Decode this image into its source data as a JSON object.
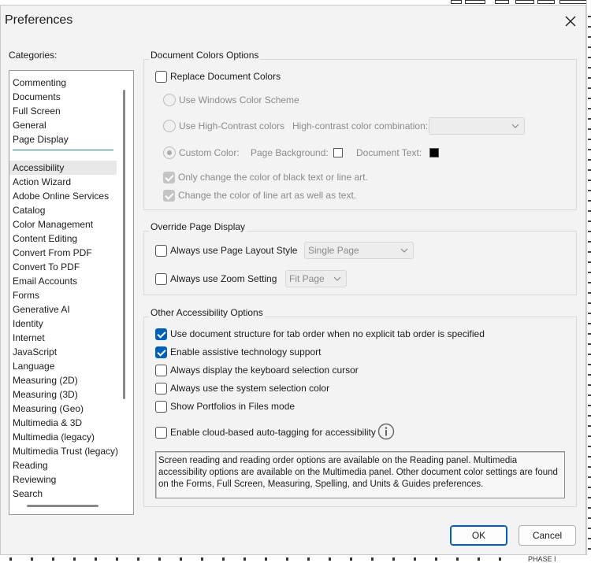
{
  "dialog": {
    "title": "Preferences",
    "close_icon": "close-icon",
    "categories_label": "Categories:",
    "categories_top": [
      "Commenting",
      "Documents",
      "Full Screen",
      "General",
      "Page Display"
    ],
    "categories": [
      "Accessibility",
      "Action Wizard",
      "Adobe Online Services",
      "Catalog",
      "Color Management",
      "Content Editing",
      "Convert From PDF",
      "Convert To PDF",
      "Email Accounts",
      "Forms",
      "Generative AI",
      "Identity",
      "Internet",
      "JavaScript",
      "Language",
      "Measuring (2D)",
      "Measuring (3D)",
      "Measuring (Geo)",
      "Multimedia & 3D",
      "Multimedia (legacy)",
      "Multimedia Trust (legacy)",
      "Reading",
      "Reviewing",
      "Search"
    ],
    "selected_category": "Accessibility"
  },
  "doc_colors": {
    "title": "Document Colors Options",
    "replace": {
      "label": "Replace Document Colors",
      "checked": false
    },
    "windows_scheme": "Use Windows Color Scheme",
    "high_contrast": "Use High-Contrast colors",
    "high_contrast_combo_label": "High-contrast color combination:",
    "high_contrast_combo_value": "",
    "custom_color": "Custom Color:",
    "page_background_label": "Page Background:",
    "page_background_color": "#ffffff",
    "document_text_label": "Document Text:",
    "document_text_color": "#000000",
    "only_black": {
      "label": "Only change the color of black text or line art.",
      "checked": true
    },
    "line_art": {
      "label": "Change the color of line art as well as text.",
      "checked": true
    }
  },
  "override": {
    "title": "Override Page Display",
    "layout": {
      "label": "Always use Page Layout Style",
      "checked": false,
      "value": "Single Page"
    },
    "zoom": {
      "label": "Always use Zoom Setting",
      "checked": false,
      "value": "Fit Page"
    }
  },
  "other": {
    "title": "Other Accessibility Options",
    "options": [
      {
        "label": "Use document structure for tab order when no explicit tab order is specified",
        "checked": true
      },
      {
        "label": "Enable assistive technology support",
        "checked": true
      },
      {
        "label": "Always display the keyboard selection cursor",
        "checked": false
      },
      {
        "label": "Always use the system selection color",
        "checked": false
      },
      {
        "label": "Show Portfolios in Files mode",
        "checked": false
      }
    ],
    "cloud": {
      "label": "Enable cloud-based auto-tagging for accessibility",
      "checked": false
    },
    "info_icon": "info-icon",
    "info_text": "Screen reading and reading order options are available on the Reading panel. Multimedia accessibility options are available on the Multimedia panel. Other document color settings are found on the Forms, Full Screen, Measuring, Spelling, and Units & Guides preferences."
  },
  "buttons": {
    "ok": "OK",
    "cancel": "Cancel"
  },
  "background": {
    "phase_text": "PHASE I"
  },
  "colors": {
    "accent": "#005fb8",
    "separator": "#2a7e8e"
  }
}
